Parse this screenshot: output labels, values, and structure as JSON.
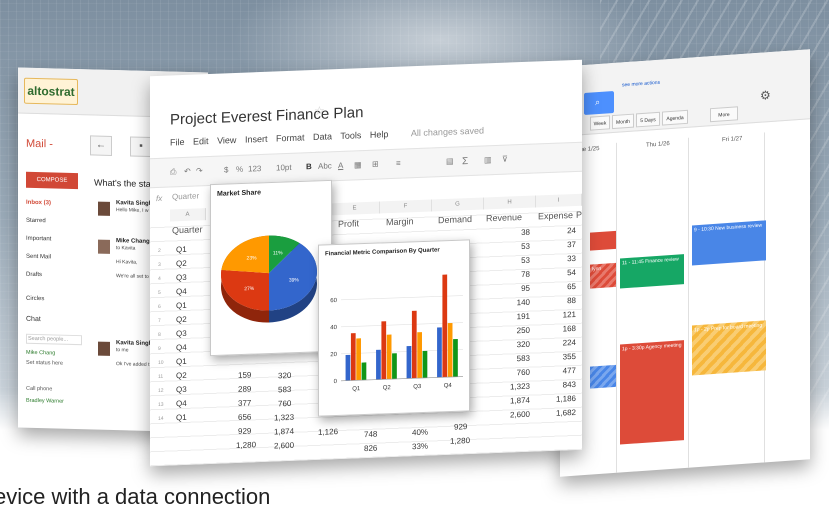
{
  "mail": {
    "logo": "altostrat",
    "label": "Mail -",
    "compose": "COMPOSE",
    "subject": "What's the status",
    "folders": [
      {
        "label": "Inbox (3)",
        "active": true
      },
      {
        "label": "Starred",
        "active": false
      },
      {
        "label": "Important",
        "active": false
      },
      {
        "label": "Sent Mail",
        "active": false
      },
      {
        "label": "Drafts",
        "active": false
      },
      {
        "label": "Circles",
        "active": false
      }
    ],
    "chat_label": "Chat",
    "search_people": "Search people...",
    "contacts": [
      "Mike Chang",
      "Set status here",
      "Call phone",
      "Bradley Warner"
    ],
    "messages": [
      {
        "from": "Kavita Singh",
        "line": "Hello Mike, I w"
      },
      {
        "from": "Mike Chang",
        "line": "to Kavita",
        "body": "Hi Kavita,",
        "body2": "We're all set to week so I hope schedule a bet"
      },
      {
        "from": "Kavita Singh",
        "line": "to me",
        "body": "Ok I've added t some additional"
      }
    ]
  },
  "calendar": {
    "link": "see more actions",
    "views": [
      "Week",
      "Month",
      "5 Days",
      "Agenda",
      "More"
    ],
    "days": [
      "Tue 1/25",
      "Thu 1/26",
      "Fri 1/27"
    ],
    "events": [
      {
        "text": "",
        "color": "#dd4b39"
      },
      {
        "text": "lynn",
        "color": "#dd4b39"
      },
      {
        "text": "11 - 11:45 Finance review",
        "color": "#16a765"
      },
      {
        "text": "9 - 10:30 New business review",
        "color": "#4986e7"
      },
      {
        "text": "1p - 2p Prep for board meeting",
        "color": "#f6b73c"
      },
      {
        "text": "1p - 3:30p Agency meeting",
        "color": "#dd4b39"
      },
      {
        "text": "",
        "color": "#4986e7"
      }
    ]
  },
  "sheet": {
    "title": "Project Everest Finance Plan",
    "menu": [
      "File",
      "Edit",
      "View",
      "Insert",
      "Format",
      "Data",
      "Tools",
      "Help"
    ],
    "saved": "All changes saved",
    "toolbar": [
      "$",
      "%",
      "123",
      "10pt",
      "B",
      "Abc",
      "A",
      "Σ"
    ],
    "fx_label": "fx",
    "fx_value": "Quarter",
    "columns": [
      "A",
      "E",
      "F",
      "G",
      "H",
      "I"
    ],
    "headers": [
      "Quarter",
      "Profit",
      "Margin",
      "Demand",
      "Revenue",
      "Expense",
      "P"
    ],
    "quarters": [
      "Q1",
      "Q2",
      "Q3",
      "Q4",
      "Q1",
      "Q2",
      "Q3",
      "Q4",
      "Q1",
      "Q2",
      "Q3",
      "Q4",
      "Q1"
    ],
    "col_b": [
      "159",
      "289",
      "377",
      "656",
      "929",
      "1,280"
    ],
    "col_c": [
      "320",
      "583",
      "760",
      "1,323",
      "1,874",
      "2,600"
    ],
    "profit_partial": [
      "1,126"
    ],
    "margin_partial": [
      "748",
      "826"
    ],
    "margin_pct": [
      "40%",
      "33%"
    ],
    "demand_partial": [
      "929",
      "1,280"
    ],
    "revenue": [
      "38",
      "53",
      "53",
      "78",
      "95",
      "140",
      "191",
      "250",
      "320",
      "583",
      "760",
      "1,323",
      "1,874",
      "2,600"
    ],
    "expense": [
      "24",
      "37",
      "33",
      "54",
      "65",
      "88",
      "121",
      "168",
      "224",
      "355",
      "477",
      "843",
      "1,186",
      "1,682"
    ]
  },
  "pie": {
    "title": "Market Share",
    "slices": [
      {
        "label": "11%",
        "value": 11,
        "color": "#1a9e3f"
      },
      {
        "label": "39%",
        "value": 39,
        "color": "#3366cc"
      },
      {
        "label": "27%",
        "value": 27,
        "color": "#dc3912"
      },
      {
        "label": "23%",
        "value": 23,
        "color": "#ff9900"
      }
    ]
  },
  "chart_data": {
    "type": "bar",
    "title": "Financial Metric Comparison By Quarter",
    "categories": [
      "Q1",
      "Q2",
      "Q3",
      "Q4"
    ],
    "ylim": [
      0,
      80
    ],
    "yticks": [
      0,
      20,
      40,
      60
    ],
    "series": [
      {
        "values": [
          19,
          22,
          24,
          37
        ],
        "color": "#3366cc"
      },
      {
        "values": [
          35,
          43,
          50,
          76
        ],
        "color": "#dc3912"
      },
      {
        "values": [
          31,
          33,
          34,
          40
        ],
        "color": "#ff9900"
      },
      {
        "values": [
          13,
          19,
          20,
          28
        ],
        "color": "#109618"
      }
    ]
  },
  "caption": "evice with a data connection"
}
